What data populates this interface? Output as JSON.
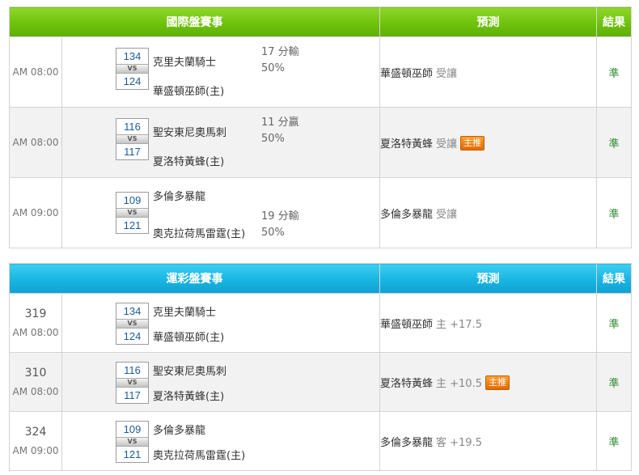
{
  "international": {
    "header": {
      "match": "國際盤賽事",
      "prediction": "預測",
      "result": "結果"
    },
    "rows": [
      {
        "time": "AM 08:00",
        "score_a": "134",
        "score_b": "124",
        "team_a": "克里夫蘭騎士",
        "team_b": "華盛頓巫師(主)",
        "spread_line1": "17 分輸",
        "spread_line2": "50%",
        "pick": "華盛頓巫師",
        "pick_label": "受讓",
        "badge": "",
        "result": "準"
      },
      {
        "time": "AM 08:00",
        "score_a": "116",
        "score_b": "117",
        "team_a": "聖安東尼奧馬刺",
        "team_b": "夏洛特黃蜂(主)",
        "spread_line1": "11 分贏",
        "spread_line2": "50%",
        "pick": "夏洛特黃蜂",
        "pick_label": "受讓",
        "badge": "主推",
        "result": "準"
      },
      {
        "time": "AM 09:00",
        "score_a": "109",
        "score_b": "121",
        "team_a": "多倫多暴龍",
        "team_b": "奧克拉荷馬雷霆(主)",
        "spread_line1": "19 分輸",
        "spread_line2": "50%",
        "pick": "多倫多暴龍",
        "pick_label": "受讓",
        "badge": "",
        "result": "準"
      }
    ]
  },
  "lottery": {
    "header": {
      "match": "運彩盤賽事",
      "prediction": "預測",
      "result": "結果"
    },
    "rows": [
      {
        "num": "319",
        "time": "AM 08:00",
        "score_a": "134",
        "score_b": "124",
        "team_a": "克里夫蘭騎士",
        "team_b": "華盛頓巫師(主)",
        "pick": "華盛頓巫師",
        "pick_label": "主 +17.5",
        "badge": "",
        "result": "準"
      },
      {
        "num": "310",
        "time": "AM 08:00",
        "score_a": "116",
        "score_b": "117",
        "team_a": "聖安東尼奧馬刺",
        "team_b": "夏洛特黃蜂(主)",
        "pick": "夏洛特黃蜂",
        "pick_label": "主 +10.5",
        "badge": "主推",
        "result": "準"
      },
      {
        "num": "324",
        "time": "AM 09:00",
        "score_a": "109",
        "score_b": "121",
        "team_a": "多倫多暴龍",
        "team_b": "奧克拉荷馬雷霆(主)",
        "pick": "多倫多暴龍",
        "pick_label": "客 +19.5",
        "badge": "",
        "result": "準"
      }
    ]
  }
}
